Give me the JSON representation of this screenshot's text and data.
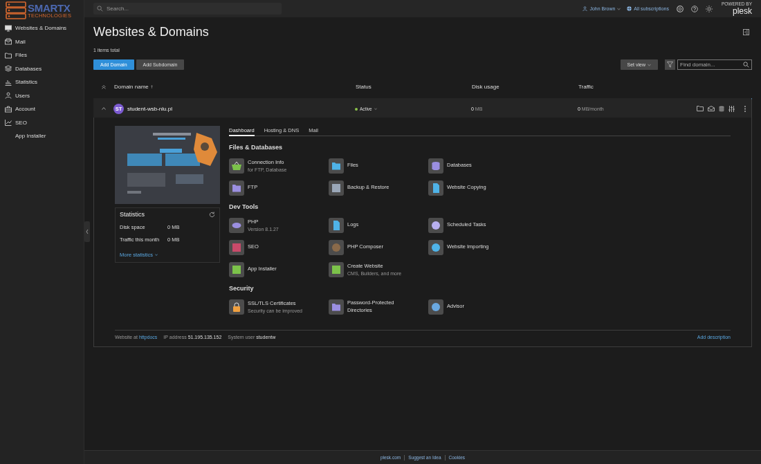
{
  "logo": {
    "line1": "SMARTX",
    "line2": "TECHNOLOGIES"
  },
  "sidebar": {
    "items": [
      {
        "label": "Websites & Domains"
      },
      {
        "label": "Mail"
      },
      {
        "label": "Files"
      },
      {
        "label": "Databases"
      },
      {
        "label": "Statistics"
      },
      {
        "label": "Users"
      },
      {
        "label": "Account"
      },
      {
        "label": "SEO"
      },
      {
        "label": "App Installer"
      }
    ]
  },
  "search": {
    "placeholder": "Search..."
  },
  "topbar": {
    "user": "John Brown",
    "subscriptions": "All subscriptions",
    "brand_top": "POWERED BY",
    "brand": "plesk"
  },
  "page": {
    "title": "Websites & Domains",
    "count": "1 items total"
  },
  "buttons": [
    {
      "label": "Add Domain",
      "kind": "primary"
    },
    {
      "label": "Add Subdomain",
      "kind": "secondary"
    }
  ],
  "set_view": "Set view",
  "find": {
    "placeholder": "Find domain..."
  },
  "table": {
    "columns": [
      "Domain name",
      "Status",
      "Disk usage",
      "Traffic"
    ],
    "rows": [
      {
        "badge": "ST",
        "name": "student-wsb-nlu.pl",
        "expanded": true,
        "status": "Active",
        "disk": "0",
        "disk_unit": "MB",
        "traffic": "0",
        "traffic_unit": "MB/month"
      }
    ]
  },
  "panel": {
    "statistics": {
      "title": "Statistics",
      "rows": [
        {
          "label": "Disk space",
          "value": "0 MB"
        },
        {
          "label": "Traffic this month",
          "value": "0 MB"
        }
      ],
      "link": "More statistics"
    },
    "tabs": [
      {
        "label": "Dashboard",
        "selected": true
      },
      {
        "label": "Hosting & DNS",
        "selected": false
      },
      {
        "label": "Mail",
        "selected": false
      }
    ],
    "sections": [
      {
        "title": "Files & Databases",
        "tools": [
          {
            "label": "Connection Info",
            "sub": "for FTP, Database"
          },
          {
            "label": "Files"
          },
          {
            "label": "Databases"
          },
          {
            "label": "FTP"
          },
          {
            "label": "Backup & Restore"
          },
          {
            "label": "Website Copying"
          }
        ]
      },
      {
        "title": "Dev Tools",
        "tools": [
          {
            "label": "PHP",
            "sub": "Version 8.1.27"
          },
          {
            "label": "Logs"
          },
          {
            "label": "Scheduled Tasks"
          },
          {
            "label": "SEO"
          },
          {
            "label": "PHP Composer"
          },
          {
            "label": "Website Importing"
          },
          {
            "label": "App Installer"
          },
          {
            "label": "Create Website",
            "sub": "CMS, Builders, and more"
          }
        ]
      },
      {
        "title": "Security",
        "tools": [
          {
            "label": "SSL/TLS Certificates",
            "sub": "Security can be improved"
          },
          {
            "label": "Password-Protected Directories"
          },
          {
            "label": "Advisor"
          }
        ]
      }
    ],
    "info": [
      {
        "label": "Website at",
        "value": "httpdocs",
        "kind": "link"
      },
      {
        "label": "IP address",
        "value": "51.195.135.152",
        "kind": "text"
      },
      {
        "label": "System user",
        "value": "studentw",
        "kind": "text"
      }
    ],
    "add_description": "Add description"
  },
  "footer": {
    "links": [
      "plesk.com",
      "Suggest an Idea",
      "Cookies"
    ]
  }
}
